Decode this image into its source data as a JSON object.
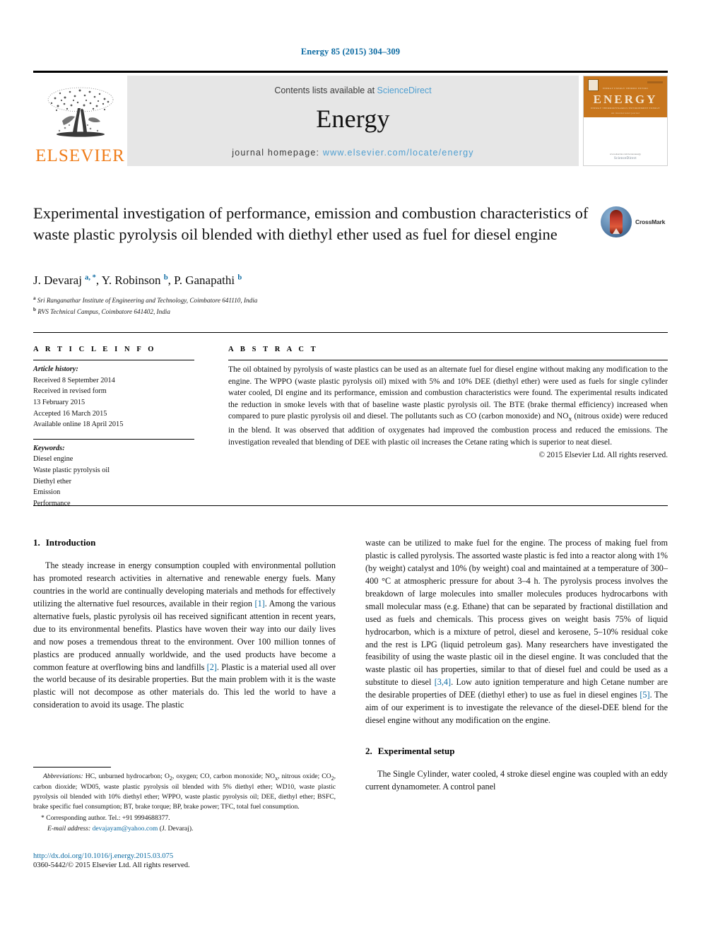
{
  "running_head": "Energy 85 (2015) 304–309",
  "masthead": {
    "publisher": "ELSEVIER",
    "contents_prefix": "Contents lists available at ",
    "contents_link": "ScienceDirect",
    "journal_name": "Energy",
    "homepage_prefix": "journal homepage: ",
    "homepage_url": "www.elsevier.com/locate/energy",
    "cover": {
      "title": "ENERGY",
      "micro_top": "ENERGY   EXERGY   THERMO   ENVIRO",
      "micro_bottom": "ENERGY    THERMODYNAMICS    ENVIRONMENT    EXERGY",
      "tagline": "An international journal",
      "sd_label": "ScienceDirect",
      "sd_sub": "www.elsevier.com/locate/energy"
    }
  },
  "article": {
    "title": "Experimental investigation of performance, emission and combustion characteristics of waste plastic pyrolysis oil blended with diethyl ether used as fuel for diesel engine",
    "crossmark_label": "CrossMark",
    "authors_html": "J. Devaraj <sup>a, *</sup>, Y. Robinson <sup>b</sup>, P. Ganapathi <sup>b</sup>",
    "affiliations": [
      {
        "mark": "a",
        "text": "Sri Ranganathar Institute of Engineering and Technology, Coimbatore 641110, India"
      },
      {
        "mark": "b",
        "text": "RVS Technical Campus, Coimbatore 641402, India"
      }
    ]
  },
  "article_info": {
    "heading": "A R T I C L E  I N F O",
    "history_label": "Article history:",
    "history": [
      "Received 8 September 2014",
      "Received in revised form",
      "13 February 2015",
      "Accepted 16 March 2015",
      "Available online 18 April 2015"
    ],
    "keywords_label": "Keywords:",
    "keywords": [
      "Diesel engine",
      "Waste plastic pyrolysis oil",
      "Diethyl ether",
      "Emission",
      "Performance"
    ]
  },
  "abstract": {
    "heading": "A B S T R A C T",
    "body": "The oil obtained by pyrolysis of waste plastics can be used as an alternate fuel for diesel engine without making any modification to the engine. The WPPO (waste plastic pyrolysis oil) mixed with 5% and 10% DEE (diethyl ether) were used as fuels for single cylinder water cooled, DI engine and its performance, emission and combustion characteristics were found. The experimental results indicated the reduction in smoke levels with that of baseline waste plastic pyrolysis oil. The BTE (brake thermal efficiency) increased when compared to pure plastic pyrolysis oil and diesel. The pollutants such as CO (carbon monoxide) and NOx (nitrous oxide) were reduced in the blend. It was observed that addition of oxygenates had improved the combustion process and reduced the emissions. The investigation revealed that blending of DEE with plastic oil increases the Cetane rating which is superior to neat diesel.",
    "copyright": "© 2015 Elsevier Ltd. All rights reserved."
  },
  "sections": {
    "intro": {
      "number": "1.",
      "title": "Introduction",
      "p1_a": "The steady increase in energy consumption coupled with environmental pollution has promoted research activities in alternative and renewable energy fuels. Many countries in the world are continually developing materials and methods for effectively utilizing the alternative fuel resources, available in their region ",
      "p1_ref1": "[1]",
      "p1_b": ". Among the various alternative fuels, plastic pyrolysis oil has received significant attention in recent years, due to its environmental benefits. Plastics have woven their way into our daily lives and now poses a tremendous threat to the environment. Over 100 million tonnes of plastics are produced annually worldwide, and the used products have become a common feature at overflowing bins and landfills ",
      "p1_ref2": "[2]",
      "p1_c": ". Plastic is a material used all over the world because of its desirable properties. But the main problem with it is the waste plastic will not decompose as other materials do. This led the world to have a consideration to avoid its usage. The plastic"
    },
    "intro_cont": {
      "a": "waste can be utilized to make fuel for the engine. The process of making fuel from plastic is called pyrolysis. The assorted waste plastic is fed into a reactor along with 1% (by weight) catalyst and 10% (by weight) coal and maintained at a temperature of 300–400 °C at atmospheric pressure for about 3–4 h. The pyrolysis process involves the breakdown of large molecules into smaller molecules produces hydrocarbons with small molecular mass (e.g. Ethane) that can be separated by fractional distillation and used as fuels and chemicals. This process gives on weight basis 75% of liquid hydrocarbon, which is a mixture of petrol, diesel and kerosene, 5–10% residual coke and the rest is LPG (liquid petroleum gas). Many researchers have investigated the feasibility of using the waste plastic oil in the diesel engine. It was concluded that the waste plastic oil has properties, similar to that of diesel fuel and could be used as a substitute to diesel ",
      "ref34": "[3,4]",
      "b": ". Low auto ignition temperature and high Cetane number are the desirable properties of DEE (diethyl ether) to use as fuel in diesel engines ",
      "ref5": "[5]",
      "c": ". The aim of our experiment is to investigate the relevance of the diesel-DEE blend for the diesel engine without any modification on the engine."
    },
    "experimental": {
      "number": "2.",
      "title": "Experimental setup",
      "p1": "The Single Cylinder, water cooled, 4 stroke diesel engine was coupled with an eddy current dynamometer. A control panel"
    }
  },
  "footnotes": {
    "abbrev_label": "Abbreviations:",
    "abbrev_text": " HC, unburned hydrocarbon; O2, oxygen; CO, carbon monoxide; NOx, nitrous oxide; CO2, carbon dioxide; WD05, waste plastic pyrolysis oil blended with 5% diethyl ether; WD10, waste plastic pyrolysis oil blended with 10% diethyl ether; WPPO, waste plastic pyrolysis oil; DEE, diethyl ether; BSFC, brake specific fuel consumption; BT, brake torque; BP, brake power; TFC, total fuel consumption.",
    "corresponding": "* Corresponding author. Tel.: +91 9994688377.",
    "email_label": "E-mail address:",
    "email": "devajayam@yahoo.com",
    "email_owner": " (J. Devaraj)."
  },
  "footer": {
    "doi": "http://dx.doi.org/10.1016/j.energy.2015.03.075",
    "issn": "0360-5442/© 2015 Elsevier Ltd. All rights reserved."
  },
  "colors": {
    "link": "#0b6aa2",
    "elsevier_orange": "#F07D1A",
    "banner_gray": "#e6e6e6",
    "cover_orange": "#C8761D"
  }
}
